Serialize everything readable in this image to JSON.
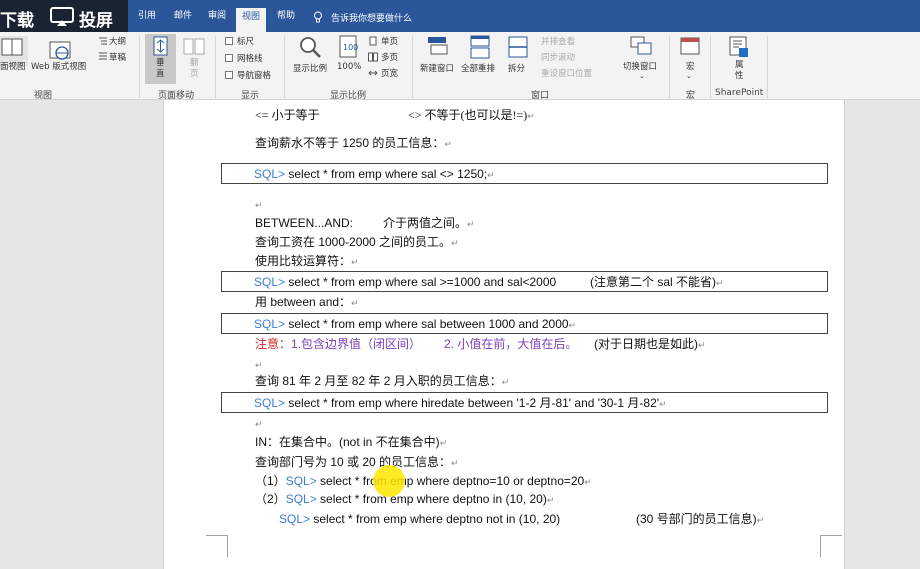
{
  "tabs": [
    {
      "label": "引用",
      "active": false
    },
    {
      "label": "邮件",
      "active": false
    },
    {
      "label": "审阅",
      "active": false
    },
    {
      "label": "视图",
      "active": true
    },
    {
      "label": "帮助",
      "active": false
    }
  ],
  "tell_me": "告诉我你想要做什么",
  "overlay": {
    "download": "下载",
    "cast": "投屏"
  },
  "ribbon": {
    "views": {
      "read_mode": "面视图",
      "web_layout": "Web 版式视图",
      "outline": "大纲",
      "draft": "草稿",
      "group": "视图"
    },
    "page_movement": {
      "vertical": "垂\n直",
      "side_by_side": "翻\n页",
      "group": "页面移动"
    },
    "show": {
      "ruler": "标尺",
      "gridlines": "网格线",
      "nav_pane": "导航窗格",
      "group": "显示"
    },
    "zoom": {
      "zoom": "显示比例",
      "zoom_100": "100%",
      "one_page": "单页",
      "multiple_pages": "多页",
      "page_width": "页宽",
      "group": "显示比例"
    },
    "window": {
      "new_window": "新建窗口",
      "arrange_all": "全部重排",
      "split": "拆分",
      "view_side": "并排查看",
      "sync_scroll": "同步滚动",
      "reset_pos": "重设窗口位置",
      "switch": "切换窗口",
      "group": "窗口"
    },
    "macros": {
      "label": "宏",
      "group": "宏"
    },
    "sharepoint": {
      "label": "属\n性",
      "group": "SharePoint"
    }
  },
  "doc": {
    "l1a": "<=  小于等于",
    "l1b": "<>  不等于(也可以是!=)",
    "l2": "查询薪水不等于 1250 的员工信息：",
    "sql_prompt": "SQL>",
    "q1": " select * from emp where sal <> 1250;",
    "l4": "BETWEEN...AND:",
    "l4b": "介于两值之间。",
    "l5": "查询工资在 1000-2000 之间的员工。",
    "l6": "使用比较运算符：",
    "q2": " select * from emp where sal >=1000 and sal<2000",
    "q2note": "(注意第二个 sal 不能省)",
    "l8": "用 between and：",
    "q3": " select * from emp where sal between 1000 and 2000",
    "note_label": "注意：",
    "note1": "1.包含边界值（闭区间）",
    "note2": "2.  小值在前，大值在后。",
    "note3": "(对于日期也是如此)",
    "l11": "查询 81 年 2 月至 82 年 2 月入职的员工信息：",
    "q4": " select * from emp where hiredate between '1-2 月-81' and '30-1 月-82'",
    "l13": "IN：在集合中。(not in  不在集合中)",
    "l14": "查询部门号为 10 或 20 的员工信息：",
    "n1": "（1）",
    "q5": " select * from emp where deptno=10 or deptno=20",
    "n2": "（2）",
    "q6": " select * from emp where deptno in (10, 20)",
    "q7": " select * from emp where deptno not in (10, 20)",
    "q7note": "(30 号部门的员工信息)"
  },
  "colors": {
    "ribbon_blue": "#2b579a",
    "sql_prompt": "#3b7dd8",
    "note_red": "#d12a2a",
    "note_purple": "#7a3fb8",
    "cursor_highlight": "#ffe600"
  }
}
